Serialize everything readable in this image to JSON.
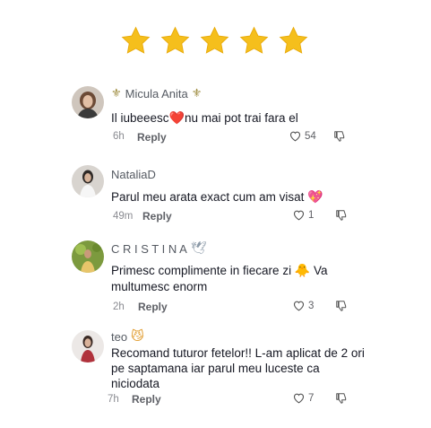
{
  "rating": {
    "stars": 5,
    "star_color": "#f5bf1c"
  },
  "comments": [
    {
      "username": "Micula Anita",
      "username_prefix": "⚜",
      "username_suffix": "⚜",
      "text": "Il iubeeesc",
      "emoji_mid": "❤️",
      "text_after": "nu mai pot trai fara el",
      "time": "6h",
      "reply": "Reply",
      "likes": "54",
      "avatar_icon": "avatar-woman-photo"
    },
    {
      "username": "NataliaD",
      "text": "Parul meu arata exact cum am visat",
      "emoji_end": "💖",
      "time": "49m",
      "reply": "Reply",
      "likes": "1",
      "avatar_icon": "avatar-woman-photo"
    },
    {
      "username": "C R I S T I N A",
      "username_suffix": "🕊",
      "text": "Primesc complimente in fiecare zi",
      "emoji_mid": "🐥",
      "text_after": "Va multumesc enorm",
      "time": "2h",
      "reply": "Reply",
      "likes": "3",
      "avatar_icon": "avatar-woman-photo"
    },
    {
      "username": "teo",
      "username_suffix": "😼",
      "text": "Recomand tuturor fetelor!! L-am aplicat de 2 ori pe saptamana iar parul meu luceste ca niciodata",
      "time": "7h",
      "reply": "Reply",
      "likes": "7",
      "avatar_icon": "avatar-woman-photo"
    }
  ],
  "icons": {
    "like": "heart-outline-icon",
    "dislike": "thumbs-down-icon"
  }
}
